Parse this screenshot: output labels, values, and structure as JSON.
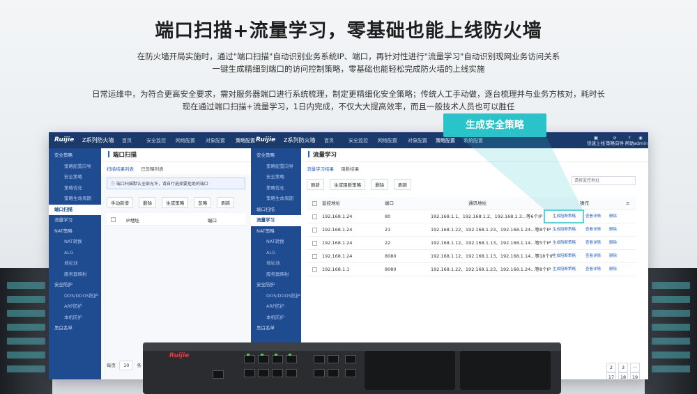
{
  "hero": {
    "title": "端口扫描+流量学习，零基础也能上线防火墙",
    "line1": "在防火墙开局实施时，通过\"端口扫描\"自动识别业务系统IP、端口，再针对性进行\"流量学习\"自动识别现网业务访问关系",
    "line2": "一键生成精细到端口的访问控制策略，零基础也能轻松完成防火墙的上线实施",
    "line3": "日常运维中，为符合更高安全要求，需对服务器端口进行系统梳理，制定更精细化安全策略；传统人工手动做，逐台梳理并与业务方核对，耗时长",
    "line4": "现在通过端口扫描+流量学习，1日内完成，不仅大大提高效率，而且一般技术人员也可以胜任"
  },
  "callout": "生成安全策略",
  "topbar": {
    "logo": "Ruijie",
    "product": "Z系列防火墙",
    "nav_back": [
      "首页",
      "安全监控",
      "网络配置",
      "对象配置",
      "策略配置"
    ],
    "nav_front": [
      "首页",
      "安全监控",
      "网络配置",
      "对象配置",
      "策略配置",
      "系统配置"
    ],
    "right": [
      "快速上线",
      "策略向导",
      "帮助",
      "admin"
    ]
  },
  "sidebar_back": {
    "items": [
      "安全策略",
      "策略配置向导",
      "安全策略",
      "策略优化",
      "策略生命周期",
      "端口扫描",
      "流量学习",
      "NAT策略",
      "NAT转换",
      "ALG",
      "地址池",
      "服务器映射",
      "安全防护",
      "DOS/DDOS防护",
      "ARP防护",
      "本机防护",
      "黑白名单"
    ]
  },
  "sidebar_front": {
    "items": [
      "安全策略",
      "策略配置向导",
      "安全策略",
      "策略优化",
      "策略生命周期",
      "端口扫描",
      "流量学习",
      "NAT策略",
      "NAT转换",
      "ALG",
      "地址池",
      "服务器映射",
      "安全防护",
      "DOS/DDOS防护",
      "ARP防护",
      "本机防护",
      "黑白名单"
    ]
  },
  "scan_panel": {
    "title": "端口扫描",
    "tabs": [
      "扫描结果列表",
      "已忽略列表"
    ],
    "notice": "端口扫描默认全部允许，请自行选择要拒绝的端口",
    "buttons": [
      "手动新增",
      "删除",
      "生成策略",
      "忽略",
      "刷新"
    ],
    "columns": [
      "IP地址",
      "端口"
    ],
    "footer_label": "每页",
    "page_size": "10",
    "footer_suffix": "条"
  },
  "learn_panel": {
    "title": "流量学习",
    "tabs": [
      "流量学习结果",
      "阻断结果"
    ],
    "buttons": [
      "刷新",
      "生成阻断策略",
      "删除",
      "刷新"
    ],
    "search_placeholder": "请按监控地址",
    "columns": [
      "监控地址",
      "端口",
      "通讯地址",
      "操作"
    ],
    "rows": [
      {
        "ip": "192.168.1.24",
        "port": "80",
        "peers": "192.168.1.1、192.168.1.2、192.168.1.3...等6个IP"
      },
      {
        "ip": "192.168.1.24",
        "port": "21",
        "peers": "192.168.1.22、192.168.1.23、192.168.1.24...等8个IP"
      },
      {
        "ip": "192.168.1.24",
        "port": "22",
        "peers": "192.168.1.12、192.168.1.13、192.168.1.14...等5个IP"
      },
      {
        "ip": "192.168.1.24",
        "port": "8080",
        "peers": "192.168.1.12、192.168.1.13、192.168.1.14...等18个IP"
      },
      {
        "ip": "192.168.1.1",
        "port": "8080",
        "peers": "192.168.1.22、192.168.1.23、192.168.1.24...等8个IP"
      }
    ],
    "actions": [
      "生成阻断策略",
      "查看详情",
      "删除"
    ],
    "pages": [
      "2",
      "3",
      "···",
      "17",
      "18",
      "19"
    ]
  },
  "device": {
    "logo": "Ruijie"
  }
}
